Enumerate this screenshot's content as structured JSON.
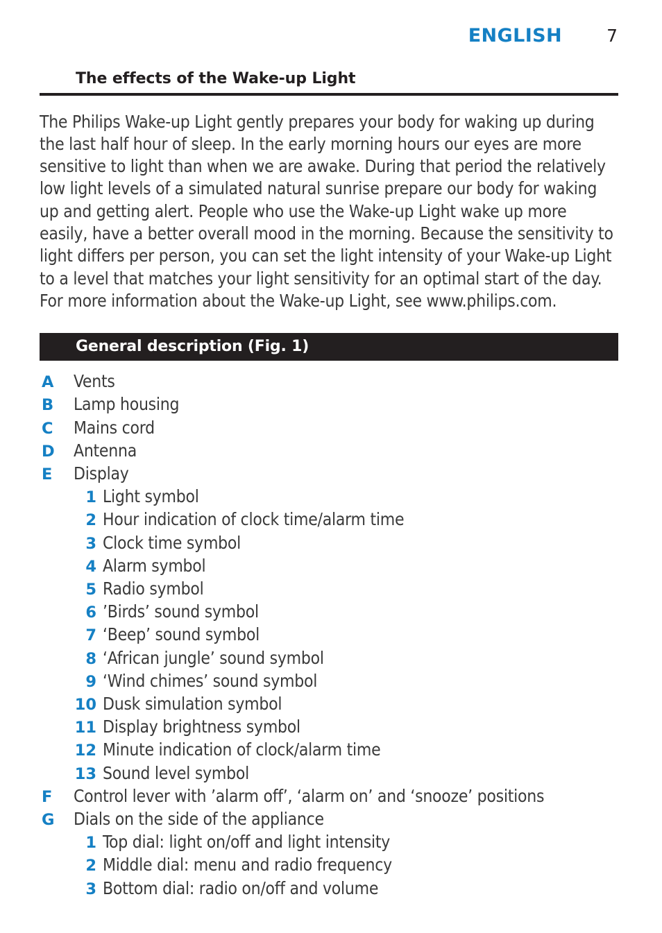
{
  "header": {
    "language": "ENGLISH",
    "page_number": "7",
    "accent_color": "#1580c4",
    "text_color": "#231f20"
  },
  "section_effects": {
    "heading": "The effects of the Wake-up Light",
    "paragraphs": [
      "The Philips Wake-up Light gently prepares your body for waking up during the last half hour of sleep. In the early morning hours our eyes are more sensitive to light than when we are awake. During that period the relatively low light levels of a simulated natural sunrise prepare our body for waking up and getting alert. People who use the Wake-up Light wake up more easily, have a better overall mood in the morning. Because the sensitivity to light differs per person, you can set the light intensity of your Wake-up Light to a level that matches your light sensitivity for an optimal start of the day.",
      "For more information about the Wake-up Light, see www.philips.com."
    ]
  },
  "section_general": {
    "banner_label": "General description (Fig. 1)",
    "banner_bg": "#231f20",
    "banner_fg": "#ffffff",
    "items": [
      {
        "level": 1,
        "marker": "A",
        "label": "Vents"
      },
      {
        "level": 1,
        "marker": "B",
        "label": "Lamp housing"
      },
      {
        "level": 1,
        "marker": "C",
        "label": "Mains cord"
      },
      {
        "level": 1,
        "marker": "D",
        "label": "Antenna"
      },
      {
        "level": 1,
        "marker": "E",
        "label": "Display"
      },
      {
        "level": 2,
        "marker": "1",
        "label": "Light symbol"
      },
      {
        "level": 2,
        "marker": "2",
        "label": "Hour indication of clock time/alarm time"
      },
      {
        "level": 2,
        "marker": "3",
        "label": "Clock time symbol"
      },
      {
        "level": 2,
        "marker": "4",
        "label": "Alarm symbol"
      },
      {
        "level": 2,
        "marker": "5",
        "label": "Radio symbol"
      },
      {
        "level": 2,
        "marker": "6",
        "label": "’Birds’ sound symbol"
      },
      {
        "level": 2,
        "marker": "7",
        "label": "‘Beep’ sound symbol"
      },
      {
        "level": 2,
        "marker": "8",
        "label": "‘African jungle’ sound symbol"
      },
      {
        "level": 2,
        "marker": "9",
        "label": "‘Wind chimes’ sound symbol"
      },
      {
        "level": 2,
        "marker": "10",
        "label": "Dusk simulation symbol"
      },
      {
        "level": 2,
        "marker": "11",
        "label": "Display brightness symbol"
      },
      {
        "level": 2,
        "marker": "12",
        "label": "Minute indication of clock/alarm time"
      },
      {
        "level": 2,
        "marker": "13",
        "label": "Sound level symbol"
      },
      {
        "level": 1,
        "marker": "F",
        "label": "Control lever with ’alarm off’, ‘alarm on’ and ‘snooze’ positions"
      },
      {
        "level": 1,
        "marker": "G",
        "label": "Dials on the side of the appliance"
      },
      {
        "level": 2,
        "marker": "1",
        "label": "Top dial: light on/off and light intensity"
      },
      {
        "level": 2,
        "marker": "2",
        "label": "Middle dial: menu and radio frequency"
      },
      {
        "level": 2,
        "marker": "3",
        "label": "Bottom dial: radio on/off and volume"
      }
    ]
  }
}
